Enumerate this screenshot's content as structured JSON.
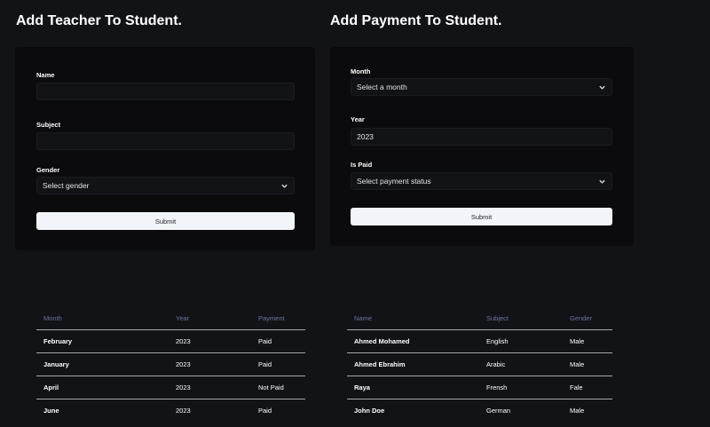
{
  "teacher_form": {
    "title": "Add Teacher To Student.",
    "name_label": "Name",
    "name_value": "",
    "subject_label": "Subject",
    "subject_value": "",
    "gender_label": "Gender",
    "gender_selected": "Select gender",
    "submit_label": "Submit"
  },
  "payment_form": {
    "title": "Add Payment To Student.",
    "month_label": "Month",
    "month_selected": "Select a month",
    "year_label": "Year",
    "year_value": "2023",
    "is_paid_label": "Is Paid",
    "is_paid_selected": "Select payment status",
    "submit_label": "Submit"
  },
  "payments_table": {
    "headers": [
      "Month",
      "Year",
      "Payment"
    ],
    "rows": [
      [
        "February",
        "2023",
        "Paid"
      ],
      [
        "January",
        "2023",
        "Paid"
      ],
      [
        "April",
        "2023",
        "Not Paid"
      ],
      [
        "June",
        "2023",
        "Paid"
      ]
    ]
  },
  "teachers_table": {
    "headers": [
      "Name",
      "Subject",
      "Gender"
    ],
    "rows": [
      [
        "Ahmed Mohamed",
        "English",
        "Male"
      ],
      [
        "Ahmed Ebrahim",
        "Arabic",
        "Male"
      ],
      [
        "Raya",
        "Frensh",
        "Fale"
      ],
      [
        "John Doe",
        "German",
        "Male"
      ]
    ]
  },
  "icons": {
    "select_arrow": "chevron-down-icon"
  },
  "colors": {
    "background": "#121317",
    "card": "#0b0b0d",
    "button": "#f1f5f9",
    "table_header_text": "#6b74a0"
  }
}
